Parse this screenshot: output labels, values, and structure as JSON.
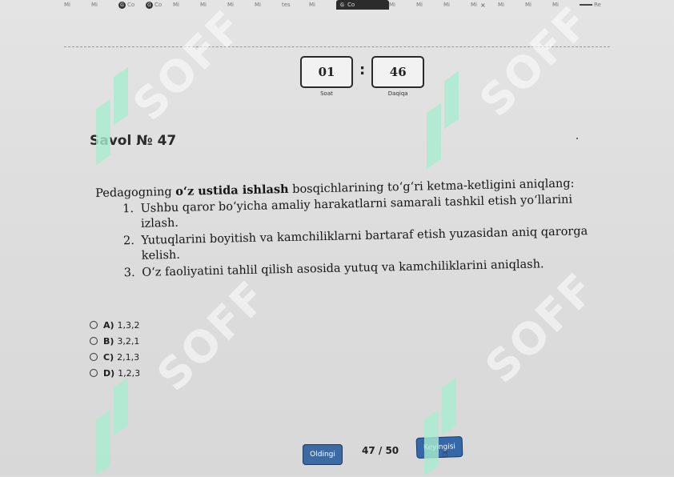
{
  "tabs": [
    {
      "label": "Mi"
    },
    {
      "label": "Mi"
    },
    {
      "label": "Co"
    },
    {
      "label": "Co"
    },
    {
      "label": "Mi"
    },
    {
      "label": "Mi"
    },
    {
      "label": "Mi"
    },
    {
      "label": "Mi"
    },
    {
      "label": "tes"
    },
    {
      "label": "Mi"
    },
    {
      "label": "Co"
    },
    {
      "label": "Mi"
    },
    {
      "label": "Mi"
    },
    {
      "label": "Mi"
    },
    {
      "label": "Mi"
    },
    {
      "label": "Mi"
    },
    {
      "label": "Mi"
    },
    {
      "label": "Mi"
    },
    {
      "label": "Re"
    }
  ],
  "tab_close": "×",
  "timer": {
    "hours": "01",
    "hours_label": "Soat",
    "separator": ":",
    "minutes": "46",
    "minutes_label": "Daqiqa"
  },
  "question": {
    "title": "Savol № 47",
    "intro_before": "Pedagogning ",
    "intro_bold": "o‘z ustida ishlash",
    "intro_after": " bosqichlarining to‘g‘ri ketma-ketligini aniqlang:",
    "items": [
      "Ushbu qaror bo‘yicha amaliy harakatlarni samarali tashkil etish yo‘llarini izlash.",
      "Yutuqlarini boyitish va kamchiliklarni bartaraf etish yuzasidan aniq qarorga kelish.",
      "O‘z faoliyatini tahlil qilish asosida yutuq va kamchiliklarini aniqlash."
    ]
  },
  "options": [
    {
      "letter": "A)",
      "text": "1,3,2"
    },
    {
      "letter": "B)",
      "text": "3,2,1"
    },
    {
      "letter": "C)",
      "text": "2,1,3"
    },
    {
      "letter": "D)",
      "text": "1,2,3"
    }
  ],
  "navigation": {
    "prev_label": "Oldingi",
    "counter": "47 / 50",
    "next_label": "Keyingisi"
  },
  "watermark": {
    "text": "SOFF",
    "color": "#a8ecd0"
  }
}
